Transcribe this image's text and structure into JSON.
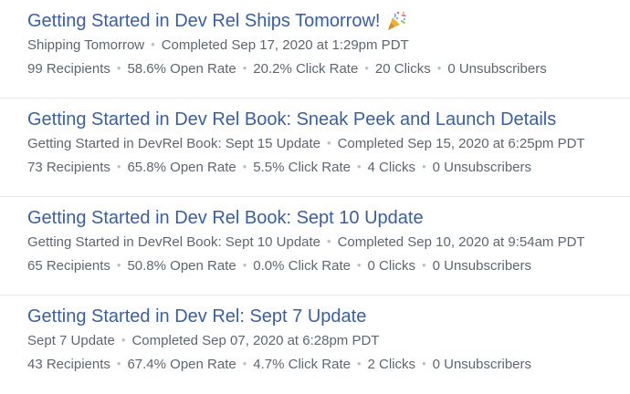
{
  "campaigns": [
    {
      "title": "Getting Started in Dev Rel Ships Tomorrow!",
      "emoji": "party-popper-icon",
      "subject": "Shipping Tomorrow",
      "completed": "Completed Sep 17, 2020 at 1:29pm PDT",
      "recipients": "99 Recipients",
      "open_rate": "58.6% Open Rate",
      "click_rate": "20.2% Click Rate",
      "clicks": "20 Clicks",
      "unsubscribers": "0 Unsubscribers"
    },
    {
      "title": "Getting Started in Dev Rel Book: Sneak Peek and Launch Details",
      "subject": "Getting Started in DevRel Book: Sept 15 Update",
      "completed": "Completed Sep 15, 2020 at 6:25pm PDT",
      "recipients": "73 Recipients",
      "open_rate": "65.8% Open Rate",
      "click_rate": "5.5% Click Rate",
      "clicks": "4 Clicks",
      "unsubscribers": "0 Unsubscribers"
    },
    {
      "title": "Getting Started in Dev Rel Book: Sept 10 Update",
      "subject": "Getting Started in DevRel Book: Sept 10 Update",
      "completed": "Completed Sep 10, 2020 at 9:54am PDT",
      "recipients": "65 Recipients",
      "open_rate": "50.8% Open Rate",
      "click_rate": "0.0% Click Rate",
      "clicks": "0 Clicks",
      "unsubscribers": "0 Unsubscribers"
    },
    {
      "title": "Getting Started in Dev Rel: Sept 7 Update",
      "subject": "Sept 7 Update",
      "completed": "Completed Sep 07, 2020 at 6:28pm PDT",
      "recipients": "43 Recipients",
      "open_rate": "67.4% Open Rate",
      "click_rate": "4.7% Click Rate",
      "clicks": "2 Clicks",
      "unsubscribers": "0 Unsubscribers"
    }
  ],
  "separator": "•",
  "colors": {
    "title_link": "#3a5fa0",
    "meta_text": "#5d6670",
    "separator": "#b9bfc6",
    "divider": "#e3e6ea"
  }
}
